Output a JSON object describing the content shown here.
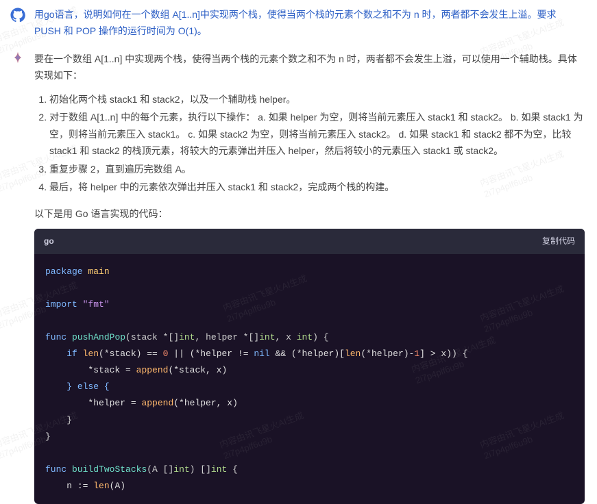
{
  "user_message": "用go语言，说明如何在一个数组 A[1..n]中实现两个栈，使得当两个栈的元素个数之和不为 n 时，两者都不会发生上溢。要求 PUSH 和 POP 操作的运行时间为 O(1)。",
  "assistant": {
    "intro": "要在一个数组 A[1..n] 中实现两个栈，使得当两个栈的元素个数之和不为 n 时，两者都不会发生上溢，可以使用一个辅助栈。具体实现如下：",
    "steps": [
      "初始化两个栈 stack1 和 stack2，以及一个辅助栈 helper。",
      "对于数组 A[1..n] 中的每个元素，执行以下操作：  a. 如果 helper 为空，则将当前元素压入 stack1 和 stack2。  b. 如果 stack1 为空，则将当前元素压入 stack1。  c. 如果 stack2 为空，则将当前元素压入 stack2。  d. 如果 stack1 和 stack2 都不为空，比较 stack1 和 stack2 的栈顶元素，将较大的元素弹出并压入 helper，然后将较小的元素压入 stack1 或 stack2。",
      "重复步骤 2，直到遍历完数组 A。",
      "最后，将 helper 中的元素依次弹出并压入 stack1 和 stack2，完成两个栈的构建。"
    ],
    "code_lead": "以下是用 Go 语言实现的代码：",
    "code": {
      "lang": "go",
      "copy_label": "复制代码",
      "lines": {
        "l1_pkg": "package",
        "l1_main": "main",
        "l3_import": "import",
        "l3_fmt": "\"fmt\"",
        "l5_func": "func",
        "l5_name": "pushAndPop",
        "l5_sig_a": "(stack *[]",
        "l5_int1": "int",
        "l5_sig_b": ", helper *[]",
        "l5_int2": "int",
        "l5_sig_c": ", x ",
        "l5_int3": "int",
        "l5_sig_d": ") {",
        "l6_if": "if",
        "l6_len": "len",
        "l6_a": "(*stack) == ",
        "l6_zero": "0",
        "l6_b": " || (*helper != ",
        "l6_nil": "nil",
        "l6_c": " && (*helper)[",
        "l6_len2": "len",
        "l6_d": "(*helper)-",
        "l6_one": "1",
        "l6_e": "] > x)) {",
        "l7_a": "*stack = ",
        "l7_append": "append",
        "l7_b": "(*stack, x)",
        "l8_else": "} else {",
        "l9_a": "*helper = ",
        "l9_append": "append",
        "l9_b": "(*helper, x)",
        "l10": "}",
        "l11": "}",
        "l13_func": "func",
        "l13_name": "buildTwoStacks",
        "l13_sig_a": "(A []",
        "l13_int": "int",
        "l13_sig_b": ") []",
        "l13_int2": "int",
        "l13_sig_c": " {",
        "l14_a": "n := ",
        "l14_len": "len",
        "l14_b": "(A)"
      }
    }
  },
  "watermark": {
    "line1": "内容由讯飞星火AI生成",
    "line2": "2i7p4plf6u9b"
  }
}
